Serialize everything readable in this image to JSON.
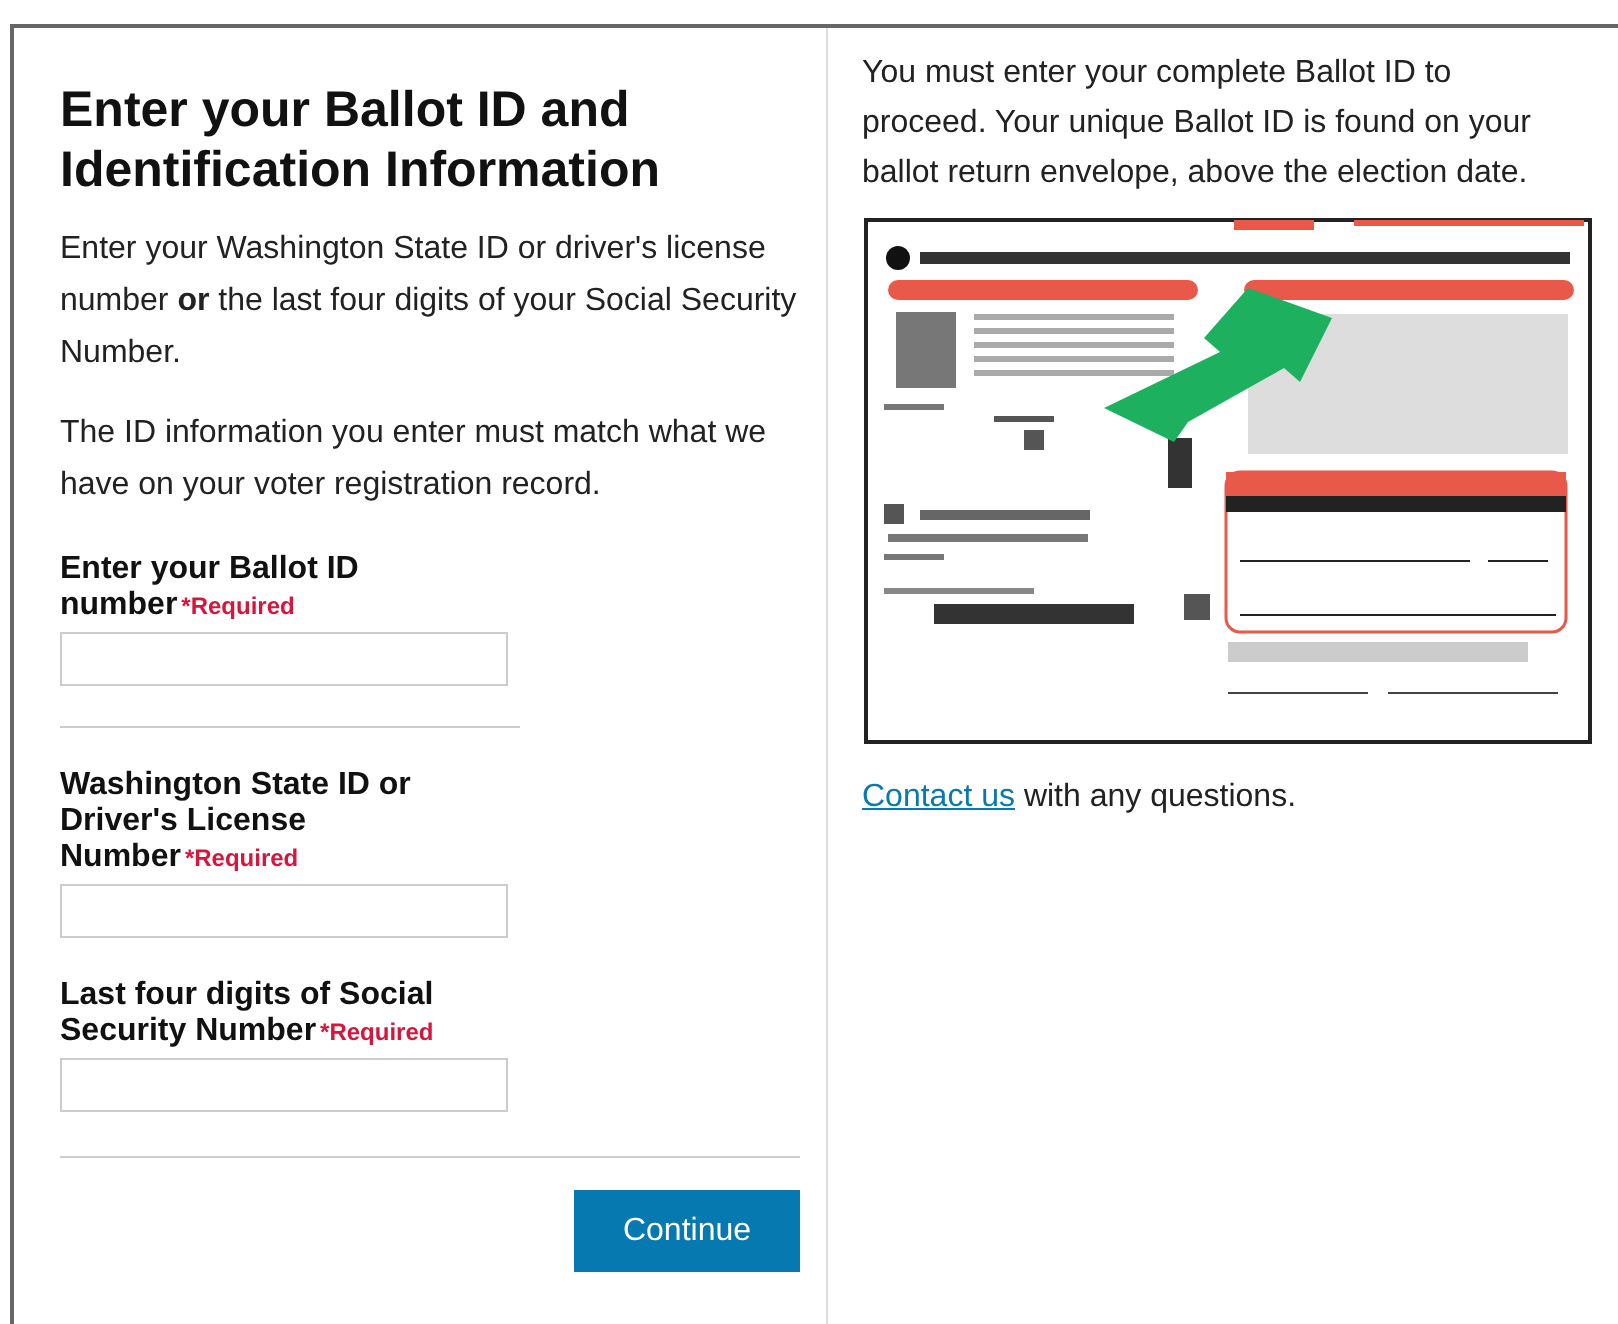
{
  "title": "Enter your Ballot ID and Identification Information",
  "intro": [
    "Enter your Washington State ID or driver's license number **or** the last four digits of your Social Security Number.",
    "The ID information you enter must match what we have on your voter registration record."
  ],
  "fields": [
    {
      "label": "Enter your Ballot ID number",
      "required": "*Required",
      "divider_after": true
    },
    {
      "label": "Washington State ID or Driver's License Number",
      "required": "*Required",
      "divider_after": false
    },
    {
      "label": "Last four digits of Social Security Number",
      "required": "*Required",
      "divider_after": false
    }
  ],
  "continue_button": "Continue",
  "help_text": "You must enter your complete Ballot ID to proceed. Your unique Ballot ID is found on your ballot return envelope, above the election date.",
  "contact": {
    "link": "Contact us",
    "text": "with any questions."
  }
}
